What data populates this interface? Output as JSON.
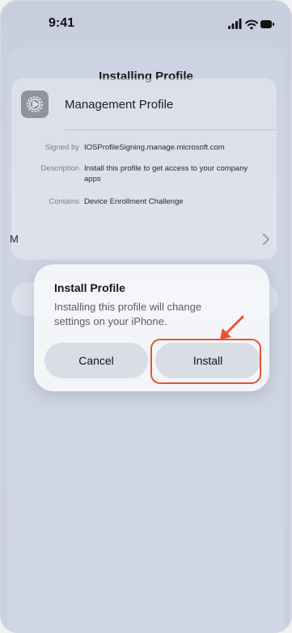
{
  "status_bar": {
    "time": "9:41"
  },
  "sheet": {
    "title": "Installing Profile"
  },
  "profile": {
    "name": "Management Profile",
    "rows": [
      {
        "key": "Signed by",
        "value": "IOSProfileSigning.manage.microsoft.com"
      },
      {
        "key": "Description",
        "value": "Install this profile to get access to your company apps"
      },
      {
        "key": "Contains",
        "value": "Device Enrollment Challenge"
      }
    ],
    "more_label_partial": "M"
  },
  "alert": {
    "title": "Install Profile",
    "message": "Installing this profile will change settings on your iPhone.",
    "cancel_label": "Cancel",
    "install_label": "Install"
  },
  "annotation": {
    "highlight_color": "#e8542f"
  },
  "icons": [
    "cellular-signal-icon",
    "wifi-icon",
    "battery-icon",
    "settings-gear-icon",
    "chevron-right-icon",
    "pointer-arrow-icon"
  ]
}
